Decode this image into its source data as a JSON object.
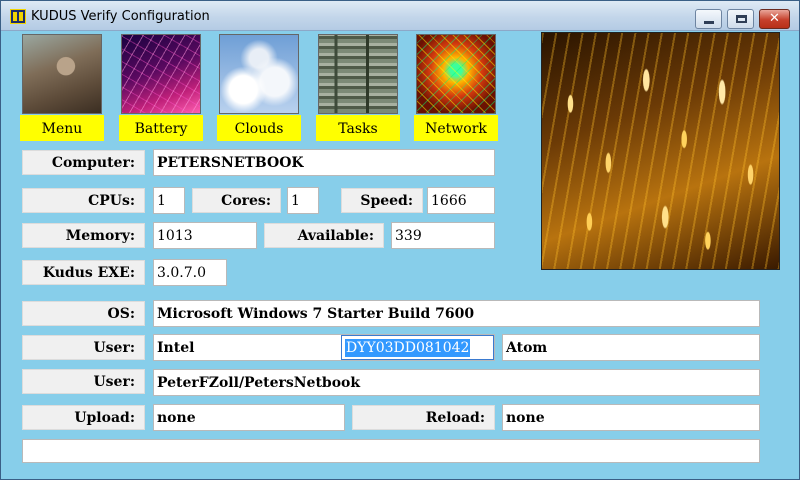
{
  "window": {
    "title": "KUDUS Verify Configuration",
    "close_glyph": "✕"
  },
  "tiles": [
    {
      "caption": "Menu",
      "icon": "kudu-antelope-picture"
    },
    {
      "caption": "Battery",
      "icon": "magenta-grid-picture"
    },
    {
      "caption": "Clouds",
      "icon": "clouds-picture"
    },
    {
      "caption": "Tasks",
      "icon": "circuit-board-picture"
    },
    {
      "caption": "Network",
      "icon": "network-grid-picture"
    }
  ],
  "fields": {
    "computer_label": "Computer:",
    "computer_value": "PETERSNETBOOK",
    "cpus_label": "CPUs:",
    "cpus_value": "1",
    "cores_label": "Cores:",
    "cores_value": "1",
    "speed_label": "Speed:",
    "speed_value": "1666",
    "memory_label": "Memory:",
    "memory_value": "1013",
    "available_label": "Available:",
    "available_value": "339",
    "kudus_exe_label": "Kudus EXE:",
    "kudus_exe_value": "3.0.7.0",
    "os_label": "OS:",
    "os_value": "Microsoft Windows 7 Starter  Build 7600",
    "user_label_1": "User:",
    "user_vendor": "Intel",
    "user_serial": "DYY03DD081042",
    "user_cpu": "Atom",
    "user_label_2": "User:",
    "user_account": "PeterFZoll/PetersNetbook",
    "upload_label": "Upload:",
    "upload_value": "none",
    "reload_label": "Reload:",
    "reload_value": "none",
    "status_value": ""
  },
  "colors": {
    "background": "#87ceea",
    "tile_caption": "#ffff00",
    "selection": "#3399ff"
  }
}
